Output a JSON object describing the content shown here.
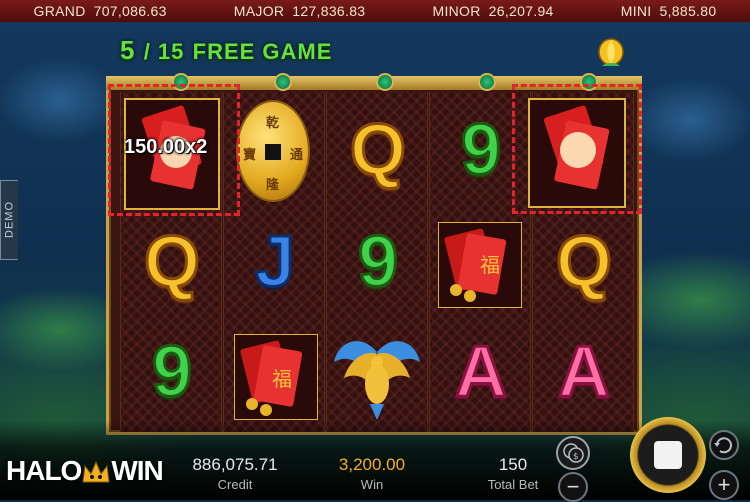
{
  "jackpots": [
    {
      "name": "GRAND",
      "value": "707,086.63"
    },
    {
      "name": "MAJOR",
      "value": "127,836.83"
    },
    {
      "name": "MINOR",
      "value": "26,207.94"
    },
    {
      "name": "MINI",
      "value": "5,885.80"
    }
  ],
  "free_game": {
    "current": "5",
    "separator": "/ 15",
    "label": "FREE GAME"
  },
  "reels": {
    "col1": [
      "red-envelope",
      "Q",
      "9"
    ],
    "col2": [
      "gold-coin",
      "J",
      "red-envelope"
    ],
    "col3": [
      "Q",
      "9",
      "phoenix"
    ],
    "col4": [
      "9",
      "red-envelope",
      "A"
    ],
    "col5": [
      "red-envelope",
      "Q",
      "A"
    ]
  },
  "coin_characters": [
    "乾",
    "通",
    "隆",
    "寶"
  ],
  "envelope_character": "福",
  "payout_label": "150.00x2",
  "demo_label": "DEMO",
  "bottom": {
    "credit_value": "886,075.71",
    "credit_label": "Credit",
    "win_value": "3,200.00",
    "win_label": "Win",
    "bet_value": "150",
    "bet_label": "Total Bet"
  },
  "logo": {
    "left": "HALO",
    "right": "WIN"
  },
  "controls": {
    "minus": "−",
    "plus": "+"
  },
  "colors": {
    "win_highlight": "#e3242b",
    "win_value": "#f2b021",
    "free_game": "#67e23d"
  }
}
